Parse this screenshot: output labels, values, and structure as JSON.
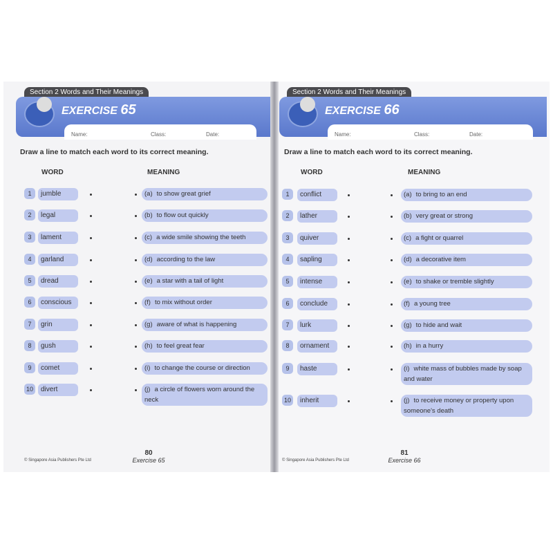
{
  "left": {
    "section": "Section 2  Words and Their Meanings",
    "exercise_label": "EXERCISE",
    "exercise_number": "65",
    "name": "Name:",
    "class": "Class:",
    "date": "Date:",
    "instruction": "Draw a line to match each word to its correct meaning.",
    "word_header": "WORD",
    "meaning_header": "MEANING",
    "rows": [
      {
        "n": "1",
        "word": "jumble",
        "letter": "(a)",
        "meaning": "to show great grief"
      },
      {
        "n": "2",
        "word": "legal",
        "letter": "(b)",
        "meaning": "to flow out quickly"
      },
      {
        "n": "3",
        "word": "lament",
        "letter": "(c)",
        "meaning": "a wide smile showing the teeth"
      },
      {
        "n": "4",
        "word": "garland",
        "letter": "(d)",
        "meaning": "according to the law"
      },
      {
        "n": "5",
        "word": "dread",
        "letter": "(e)",
        "meaning": "a star with a tail of light"
      },
      {
        "n": "6",
        "word": "conscious",
        "letter": "(f)",
        "meaning": "to mix without order"
      },
      {
        "n": "7",
        "word": "grin",
        "letter": "(g)",
        "meaning": "aware of what is happening"
      },
      {
        "n": "8",
        "word": "gush",
        "letter": "(h)",
        "meaning": "to feel great fear"
      },
      {
        "n": "9",
        "word": "comet",
        "letter": "(i)",
        "meaning": "to change the course or direction"
      },
      {
        "n": "10",
        "word": "divert",
        "letter": "(j)",
        "meaning": "a circle of flowers worn around the neck"
      }
    ],
    "copyright": "© Singapore Asia Publishers Pte Ltd",
    "page": "80",
    "page_label": "Exercise 65"
  },
  "right": {
    "section": "Section 2  Words and Their Meanings",
    "exercise_label": "EXERCISE",
    "exercise_number": "66",
    "name": "Name:",
    "class": "Class:",
    "date": "Date:",
    "instruction": "Draw a line to match each word to its correct meaning.",
    "word_header": "WORD",
    "meaning_header": "MEANING",
    "rows": [
      {
        "n": "1",
        "word": "conflict",
        "letter": "(a)",
        "meaning": "to bring to an end"
      },
      {
        "n": "2",
        "word": "lather",
        "letter": "(b)",
        "meaning": "very great or strong"
      },
      {
        "n": "3",
        "word": "quiver",
        "letter": "(c)",
        "meaning": "a fight or quarrel"
      },
      {
        "n": "4",
        "word": "sapling",
        "letter": "(d)",
        "meaning": "a decorative item"
      },
      {
        "n": "5",
        "word": "intense",
        "letter": "(e)",
        "meaning": "to shake or tremble slightly"
      },
      {
        "n": "6",
        "word": "conclude",
        "letter": "(f)",
        "meaning": "a young tree"
      },
      {
        "n": "7",
        "word": "lurk",
        "letter": "(g)",
        "meaning": "to hide and wait"
      },
      {
        "n": "8",
        "word": "ornament",
        "letter": "(h)",
        "meaning": "in a hurry"
      },
      {
        "n": "9",
        "word": "haste",
        "letter": "(i)",
        "meaning": "white mass of bubbles made by soap and water"
      },
      {
        "n": "10",
        "word": "inherit",
        "letter": "(j)",
        "meaning": "to receive money or property upon someone's death"
      }
    ],
    "copyright": "© Singapore Asia Publishers Pte Ltd",
    "page": "81",
    "page_label": "Exercise 66"
  },
  "colors": {
    "banner": "#5a78cc",
    "pill": "#c2cbef"
  }
}
